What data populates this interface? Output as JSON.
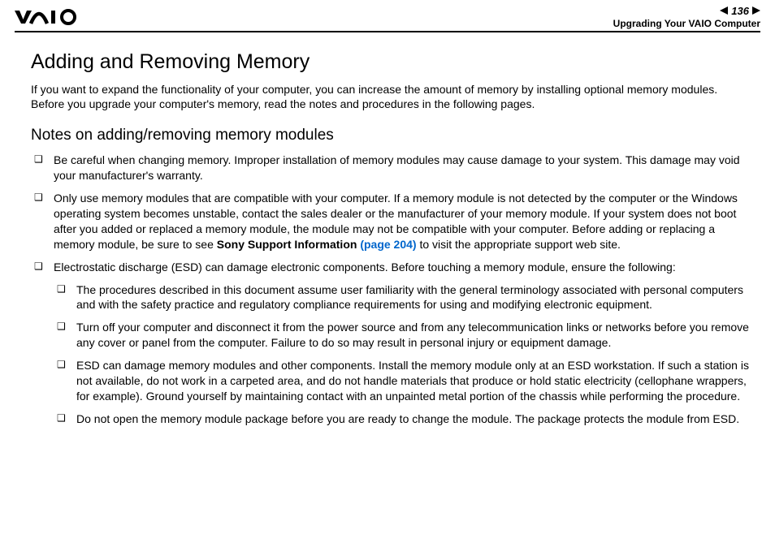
{
  "header": {
    "page_number": "136",
    "section": "Upgrading Your VAIO Computer"
  },
  "title": "Adding and Removing Memory",
  "intro": "If you want to expand the functionality of your computer, you can increase the amount of memory by installing optional memory modules. Before you upgrade your computer's memory, read the notes and procedures in the following pages.",
  "subtitle": "Notes on adding/removing memory modules",
  "notes": [
    "Be careful when changing memory. Improper installation of memory modules may cause damage to your system. This damage may void your manufacturer's warranty.",
    {
      "pre": "Only use memory modules that are compatible with your computer. If a memory module is not detected by the computer or the Windows operating system becomes unstable, contact the sales dealer or the manufacturer of your memory module. If your system does not boot after you added or replaced a memory module, the module may not be compatible with your computer. Before adding or replacing a memory module, be sure to see ",
      "bold": "Sony Support Information ",
      "link": "(page 204)",
      "post": " to visit the appropriate support web site."
    },
    "Electrostatic discharge (ESD) can damage electronic components. Before touching a memory module, ensure the following:"
  ],
  "subnotes": [
    "The procedures described in this document assume user familiarity with the general terminology associated with personal computers and with the safety practice and regulatory compliance requirements for using and modifying electronic equipment.",
    "Turn off your computer and disconnect it from the power source and from any telecommunication links or networks before you remove any cover or panel from the computer. Failure to do so may result in personal injury or equipment damage.",
    "ESD can damage memory modules and other components. Install the memory module only at an ESD workstation. If such a station is not available, do not work in a carpeted area, and do not handle materials that produce or hold static electricity (cellophane wrappers, for example). Ground yourself by maintaining contact with an unpainted metal portion of the chassis while performing the procedure.",
    "Do not open the memory module package before you are ready to change the module. The package protects the module from ESD."
  ]
}
